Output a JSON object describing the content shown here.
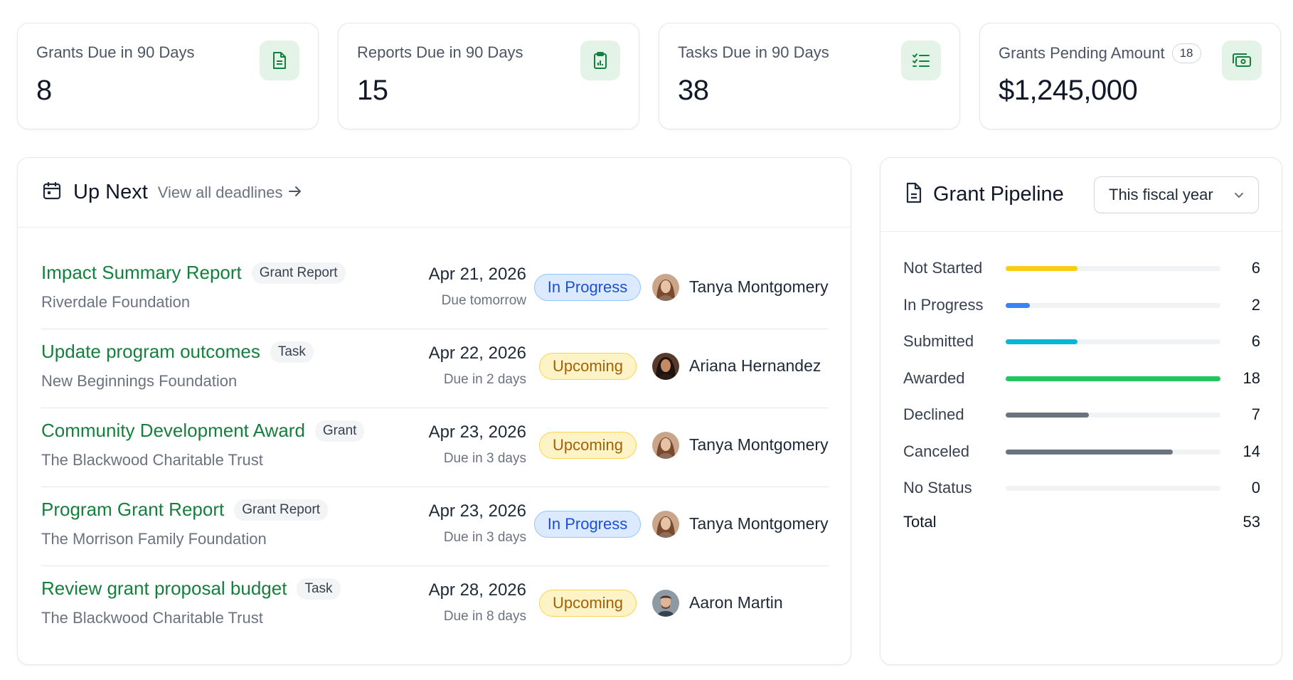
{
  "stats": [
    {
      "label": "Grants Due in 90 Days",
      "value": "8",
      "icon": "document-icon"
    },
    {
      "label": "Reports Due in 90 Days",
      "value": "15",
      "icon": "clipboard-chart-icon"
    },
    {
      "label": "Tasks Due in 90 Days",
      "value": "38",
      "icon": "checklist-icon"
    },
    {
      "label": "Grants Pending Amount",
      "badge": "18",
      "value": "$1,245,000",
      "icon": "cash-icon"
    }
  ],
  "up_next": {
    "title": "Up Next",
    "view_all": "View all deadlines",
    "items": [
      {
        "title": "Impact Summary Report",
        "type": "Grant Report",
        "org": "Riverdale Foundation",
        "date": "Apr 21, 2026",
        "due": "Due tomorrow",
        "status": "In Progress",
        "assignee": "Tanya Montgomery"
      },
      {
        "title": "Update program outcomes",
        "type": "Task",
        "org": "New Beginnings Foundation",
        "date": "Apr 22, 2026",
        "due": "Due in 2 days",
        "status": "Upcoming",
        "assignee": "Ariana Hernandez"
      },
      {
        "title": "Community Development Award",
        "type": "Grant",
        "org": "The Blackwood Charitable Trust",
        "date": "Apr 23, 2026",
        "due": "Due in 3 days",
        "status": "Upcoming",
        "assignee": "Tanya Montgomery"
      },
      {
        "title": "Program Grant Report",
        "type": "Grant Report",
        "org": "The Morrison Family Foundation",
        "date": "Apr 23, 2026",
        "due": "Due in 3 days",
        "status": "In Progress",
        "assignee": "Tanya Montgomery"
      },
      {
        "title": "Review grant proposal budget",
        "type": "Task",
        "org": "The Blackwood Charitable Trust",
        "date": "Apr 28, 2026",
        "due": "Due in 8 days",
        "status": "Upcoming",
        "assignee": "Aaron Martin"
      }
    ]
  },
  "pipeline": {
    "title": "Grant Pipeline",
    "period": "This fiscal year",
    "max": 18,
    "rows": [
      {
        "name": "Not Started",
        "value": 6,
        "color": "#facc15"
      },
      {
        "name": "In Progress",
        "value": 2,
        "color": "#3b82f6"
      },
      {
        "name": "Submitted",
        "value": 6,
        "color": "#06b6d4"
      },
      {
        "name": "Awarded",
        "value": 18,
        "color": "#22c55e"
      },
      {
        "name": "Declined",
        "value": 7,
        "color": "#6b7280"
      },
      {
        "name": "Canceled",
        "value": 14,
        "color": "#6b7280"
      },
      {
        "name": "No Status",
        "value": 0,
        "color": "#6b7280"
      }
    ],
    "total_label": "Total",
    "total": "53"
  },
  "colors": {
    "accent_green": "#15803d",
    "icon_bg": "#e3f3e7"
  }
}
